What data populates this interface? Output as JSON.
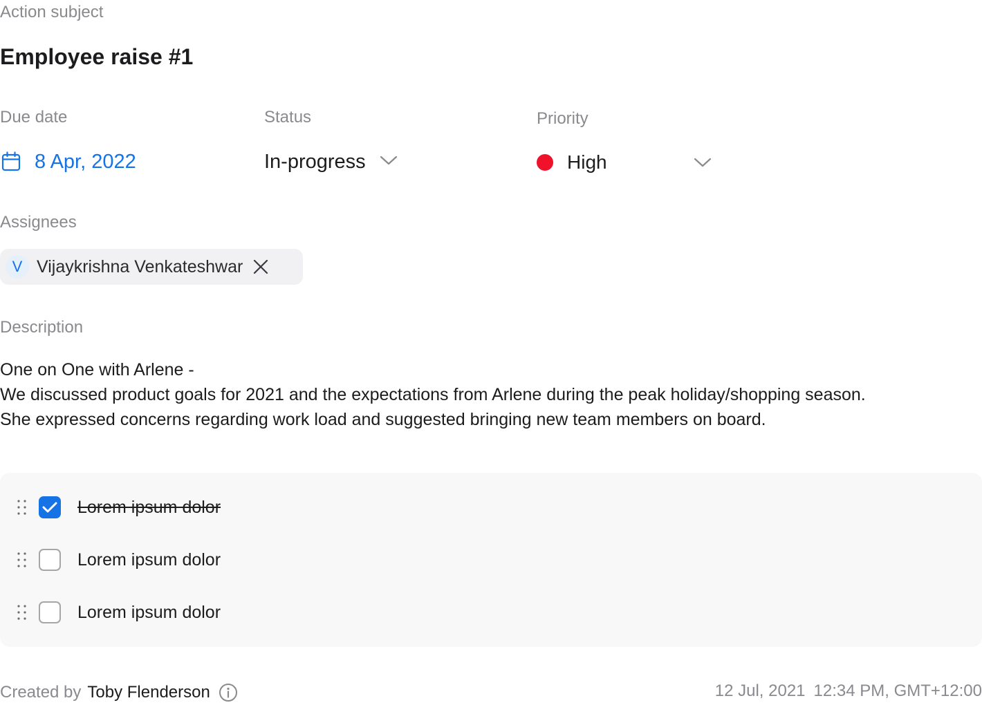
{
  "subject": {
    "label": "Action subject",
    "title": "Employee raise #1"
  },
  "fields": {
    "due_date": {
      "label": "Due date",
      "value": "8 Apr, 2022",
      "icon": "calendar-icon"
    },
    "status": {
      "label": "Status",
      "value": "In-progress",
      "icon": "chevron-down-icon"
    },
    "priority": {
      "label": "Priority",
      "value": "High",
      "color": "#f0112a",
      "icon": "chevron-down-icon"
    }
  },
  "assignees": {
    "label": "Assignees",
    "items": [
      {
        "initial": "V",
        "name": "Vijaykrishna Venkateshwar",
        "remove_icon": "close-icon"
      }
    ]
  },
  "description": {
    "label": "Description",
    "lines": [
      "One on One with Arlene -",
      "We discussed product goals for 2021 and the expectations from Arlene during the peak holiday/shopping season.",
      "She expressed concerns regarding work load and suggested bringing new team members on board."
    ]
  },
  "checklist": {
    "items": [
      {
        "text": "Lorem ipsum dolor",
        "checked": true
      },
      {
        "text": "Lorem ipsum dolor",
        "checked": false
      },
      {
        "text": "Lorem ipsum dolor",
        "checked": false
      }
    ]
  },
  "footer": {
    "created_by_label": "Created by",
    "creator": "Toby Flenderson",
    "date": "12 Jul, 2021",
    "time": "12:34 PM, GMT+12:00",
    "info_icon": "info-icon"
  },
  "colors": {
    "accent": "#1673e6",
    "priority_high": "#f0112a",
    "muted_text": "#8a8a8e",
    "checklist_bg": "#f8f8f8",
    "chip_bg": "#f1f1f3"
  }
}
